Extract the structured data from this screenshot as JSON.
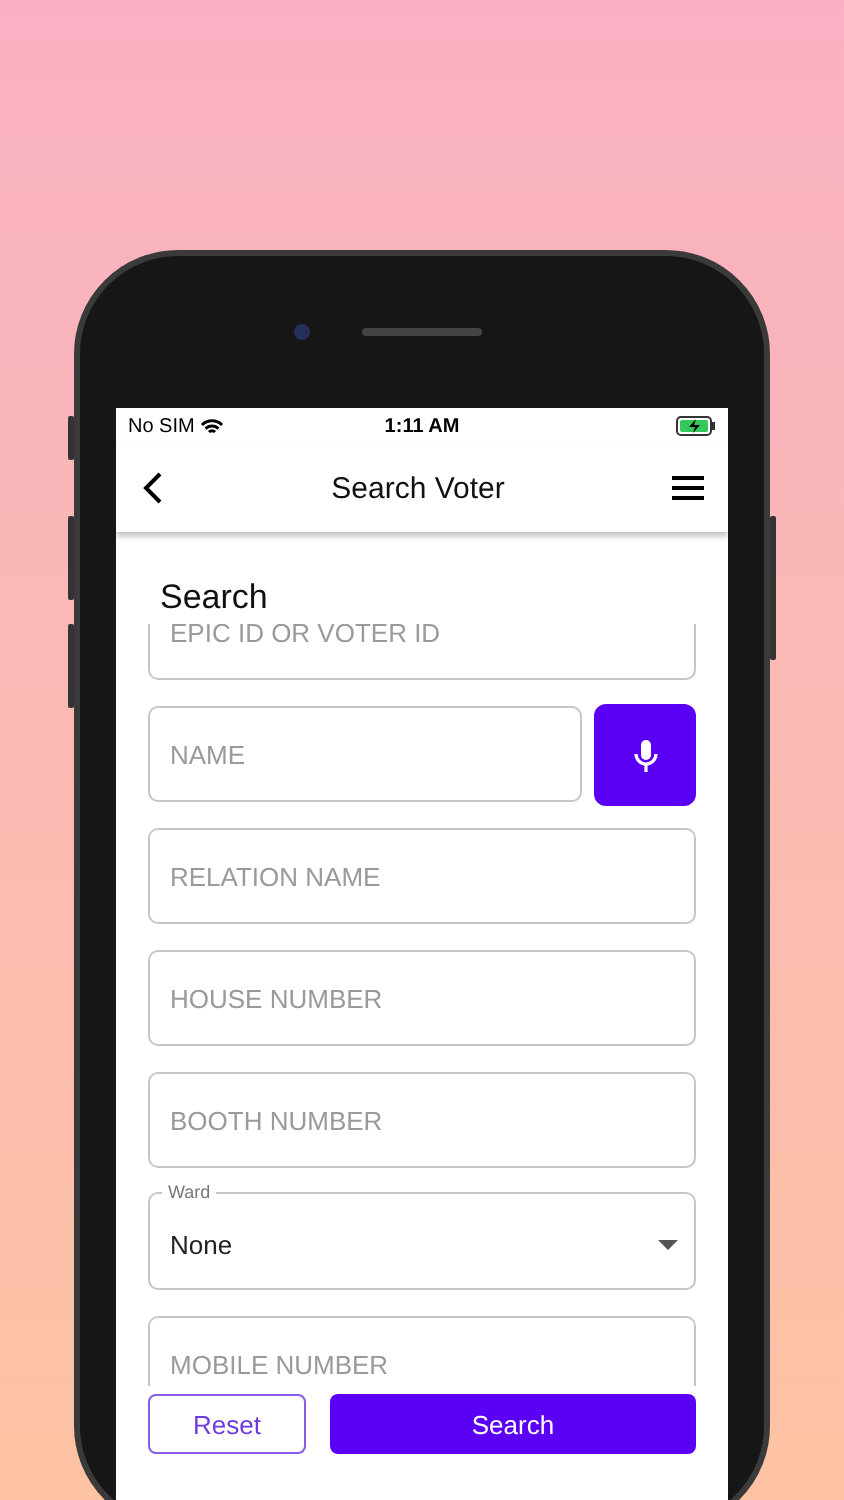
{
  "status_bar": {
    "carrier": "No SIM",
    "time": "1:11 AM",
    "charging": true
  },
  "nav": {
    "title": "Search Voter"
  },
  "form": {
    "title": "Search",
    "fields": [
      {
        "kind": "text",
        "placeholder": "EPIC ID OR VOTER ID"
      },
      {
        "kind": "voice",
        "placeholder": "NAME"
      },
      {
        "kind": "text",
        "placeholder": "RELATION NAME"
      },
      {
        "kind": "text",
        "placeholder": "HOUSE NUMBER"
      },
      {
        "kind": "text",
        "placeholder": "BOOTH NUMBER"
      },
      {
        "kind": "select",
        "label": "Ward",
        "value": "None"
      },
      {
        "kind": "text",
        "placeholder": "MOBILE NUMBER"
      }
    ]
  },
  "buttons": [
    {
      "kind": "outline",
      "label": "Reset"
    },
    {
      "kind": "filled",
      "label": "Search"
    }
  ]
}
